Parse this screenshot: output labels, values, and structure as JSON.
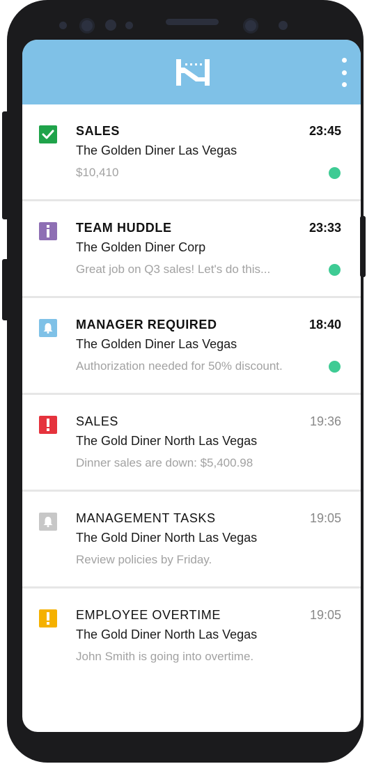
{
  "colors": {
    "header_bg": "#7fc1e7",
    "unread_dot": "#3ecb94",
    "success": "#1fa34a",
    "info": "#8e6fb4",
    "bell_blue": "#7fc1e7",
    "alert_red": "#e5333d",
    "bell_gray": "#c7c7c7",
    "warning": "#f5b100"
  },
  "header": {
    "logo_icon": "hotschedules-logo",
    "menu_icon": "more-vertical-icon"
  },
  "notifications": [
    {
      "icon": "check-icon",
      "badge_color": "#1fa34a",
      "title": "SALES",
      "time": "23:45",
      "location": "The Golden Diner Las Vegas",
      "message": "$10,410",
      "unread": true
    },
    {
      "icon": "info-icon",
      "badge_color": "#8e6fb4",
      "title": "TEAM HUDDLE",
      "time": "23:33",
      "location": "The Golden Diner Corp",
      "message": "Great job on Q3 sales! Let's do this...",
      "unread": true
    },
    {
      "icon": "bell-icon",
      "badge_color": "#7fc1e7",
      "title": "MANAGER REQUIRED",
      "time": "18:40",
      "location": "The Golden Diner Las Vegas",
      "message": "Authorization needed for 50% discount.",
      "unread": true
    },
    {
      "icon": "exclamation-icon",
      "badge_color": "#e5333d",
      "title": "SALES",
      "time": "19:36",
      "location": "The Gold Diner North Las Vegas",
      "message": "Dinner sales are down: $5,400.98",
      "unread": false
    },
    {
      "icon": "bell-icon",
      "badge_color": "#c7c7c7",
      "title": "MANAGEMENT TASKS",
      "time": "19:05",
      "location": "The Gold Diner North Las Vegas",
      "message": "Review policies by Friday.",
      "unread": false
    },
    {
      "icon": "exclamation-icon",
      "badge_color": "#f5b100",
      "title": "EMPLOYEE OVERTIME",
      "time": "19:05",
      "location": "The Gold Diner North Las Vegas",
      "message": "John Smith is going into overtime.",
      "unread": false
    }
  ]
}
